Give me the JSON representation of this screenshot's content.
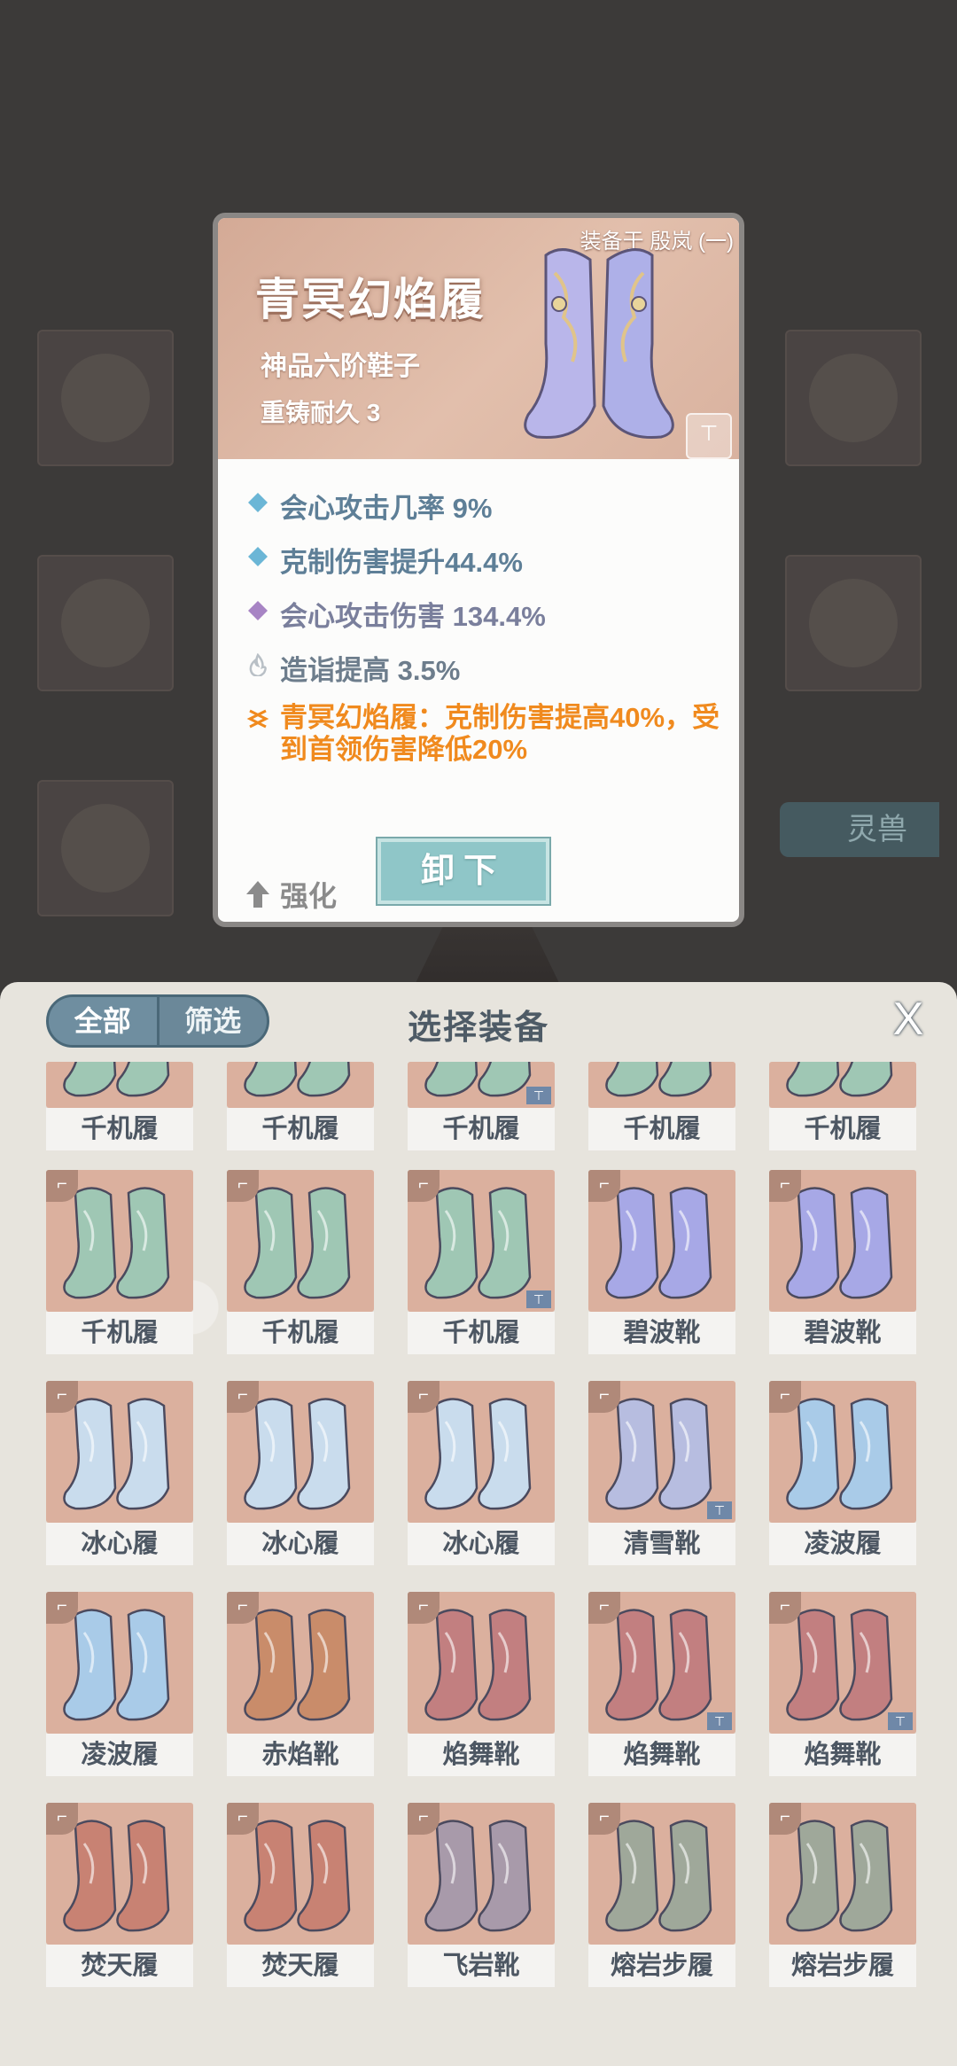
{
  "detail": {
    "equipped_on": "装备于 殷岚 (一)",
    "name": "青冥幻焰履",
    "grade": "神品六阶鞋子",
    "durability": "重铸耐久 3",
    "stats": [
      {
        "text": "会心攻击几率 9%",
        "icon": "blue-diamond-icon",
        "color": "#6bb6d6"
      },
      {
        "text": "克制伤害提升44.4%",
        "icon": "blue-diamond-icon",
        "color": "#6bb6d6"
      },
      {
        "text": "会心攻击伤害 134.4%",
        "icon": "purple-diamond-icon",
        "color": "#a784c4"
      },
      {
        "text": "造诣提高 3.5%",
        "icon": "flame-icon",
        "color": "#b9c0c6"
      }
    ],
    "set_bonus": "青冥幻焰履：克制伤害提高40%，受到首领伤害降低20%",
    "upgrade_label": "强化",
    "unequip_label": "卸下"
  },
  "background": {
    "pet_tab_label": "灵兽"
  },
  "sheet": {
    "tabs": [
      "全部",
      "筛选"
    ],
    "title": "选择装备",
    "close_label": "X"
  },
  "items": [
    {
      "name": "千机履",
      "color": "green",
      "locked": false
    },
    {
      "name": "千机履",
      "color": "green",
      "locked": false
    },
    {
      "name": "千机履",
      "color": "green",
      "locked": true
    },
    {
      "name": "千机履",
      "color": "green",
      "locked": false
    },
    {
      "name": "千机履",
      "color": "green",
      "locked": false
    },
    {
      "name": "千机履",
      "color": "green",
      "locked": false
    },
    {
      "name": "千机履",
      "color": "green",
      "locked": false
    },
    {
      "name": "千机履",
      "color": "green",
      "locked": true
    },
    {
      "name": "碧波靴",
      "color": "violet",
      "locked": false
    },
    {
      "name": "碧波靴",
      "color": "violet",
      "locked": false
    },
    {
      "name": "冰心履",
      "color": "ice",
      "locked": false
    },
    {
      "name": "冰心履",
      "color": "ice",
      "locked": false
    },
    {
      "name": "冰心履",
      "color": "ice",
      "locked": false
    },
    {
      "name": "清雪靴",
      "color": "lilac",
      "locked": true
    },
    {
      "name": "凌波履",
      "color": "sky",
      "locked": false
    },
    {
      "name": "凌波履",
      "color": "sky",
      "locked": false
    },
    {
      "name": "赤焰靴",
      "color": "copper",
      "locked": false
    },
    {
      "name": "焰舞靴",
      "color": "rose",
      "locked": false
    },
    {
      "name": "焰舞靴",
      "color": "rose",
      "locked": true
    },
    {
      "name": "焰舞靴",
      "color": "rose",
      "locked": true
    },
    {
      "name": "焚天履",
      "color": "ember",
      "locked": false
    },
    {
      "name": "焚天履",
      "color": "ember",
      "locked": false
    },
    {
      "name": "飞岩靴",
      "color": "stone",
      "locked": false
    },
    {
      "name": "熔岩步履",
      "color": "moss",
      "locked": false
    },
    {
      "name": "熔岩步履",
      "color": "moss",
      "locked": false
    }
  ],
  "palette": {
    "green": "#9fc7b4",
    "violet": "#a7a8e6",
    "ice": "#c9dced",
    "lilac": "#b7bde0",
    "sky": "#a9cbe8",
    "copper": "#c98c6a",
    "rose": "#c27f80",
    "ember": "#c88273",
    "stone": "#a89aaa",
    "moss": "#9fa89a"
  }
}
